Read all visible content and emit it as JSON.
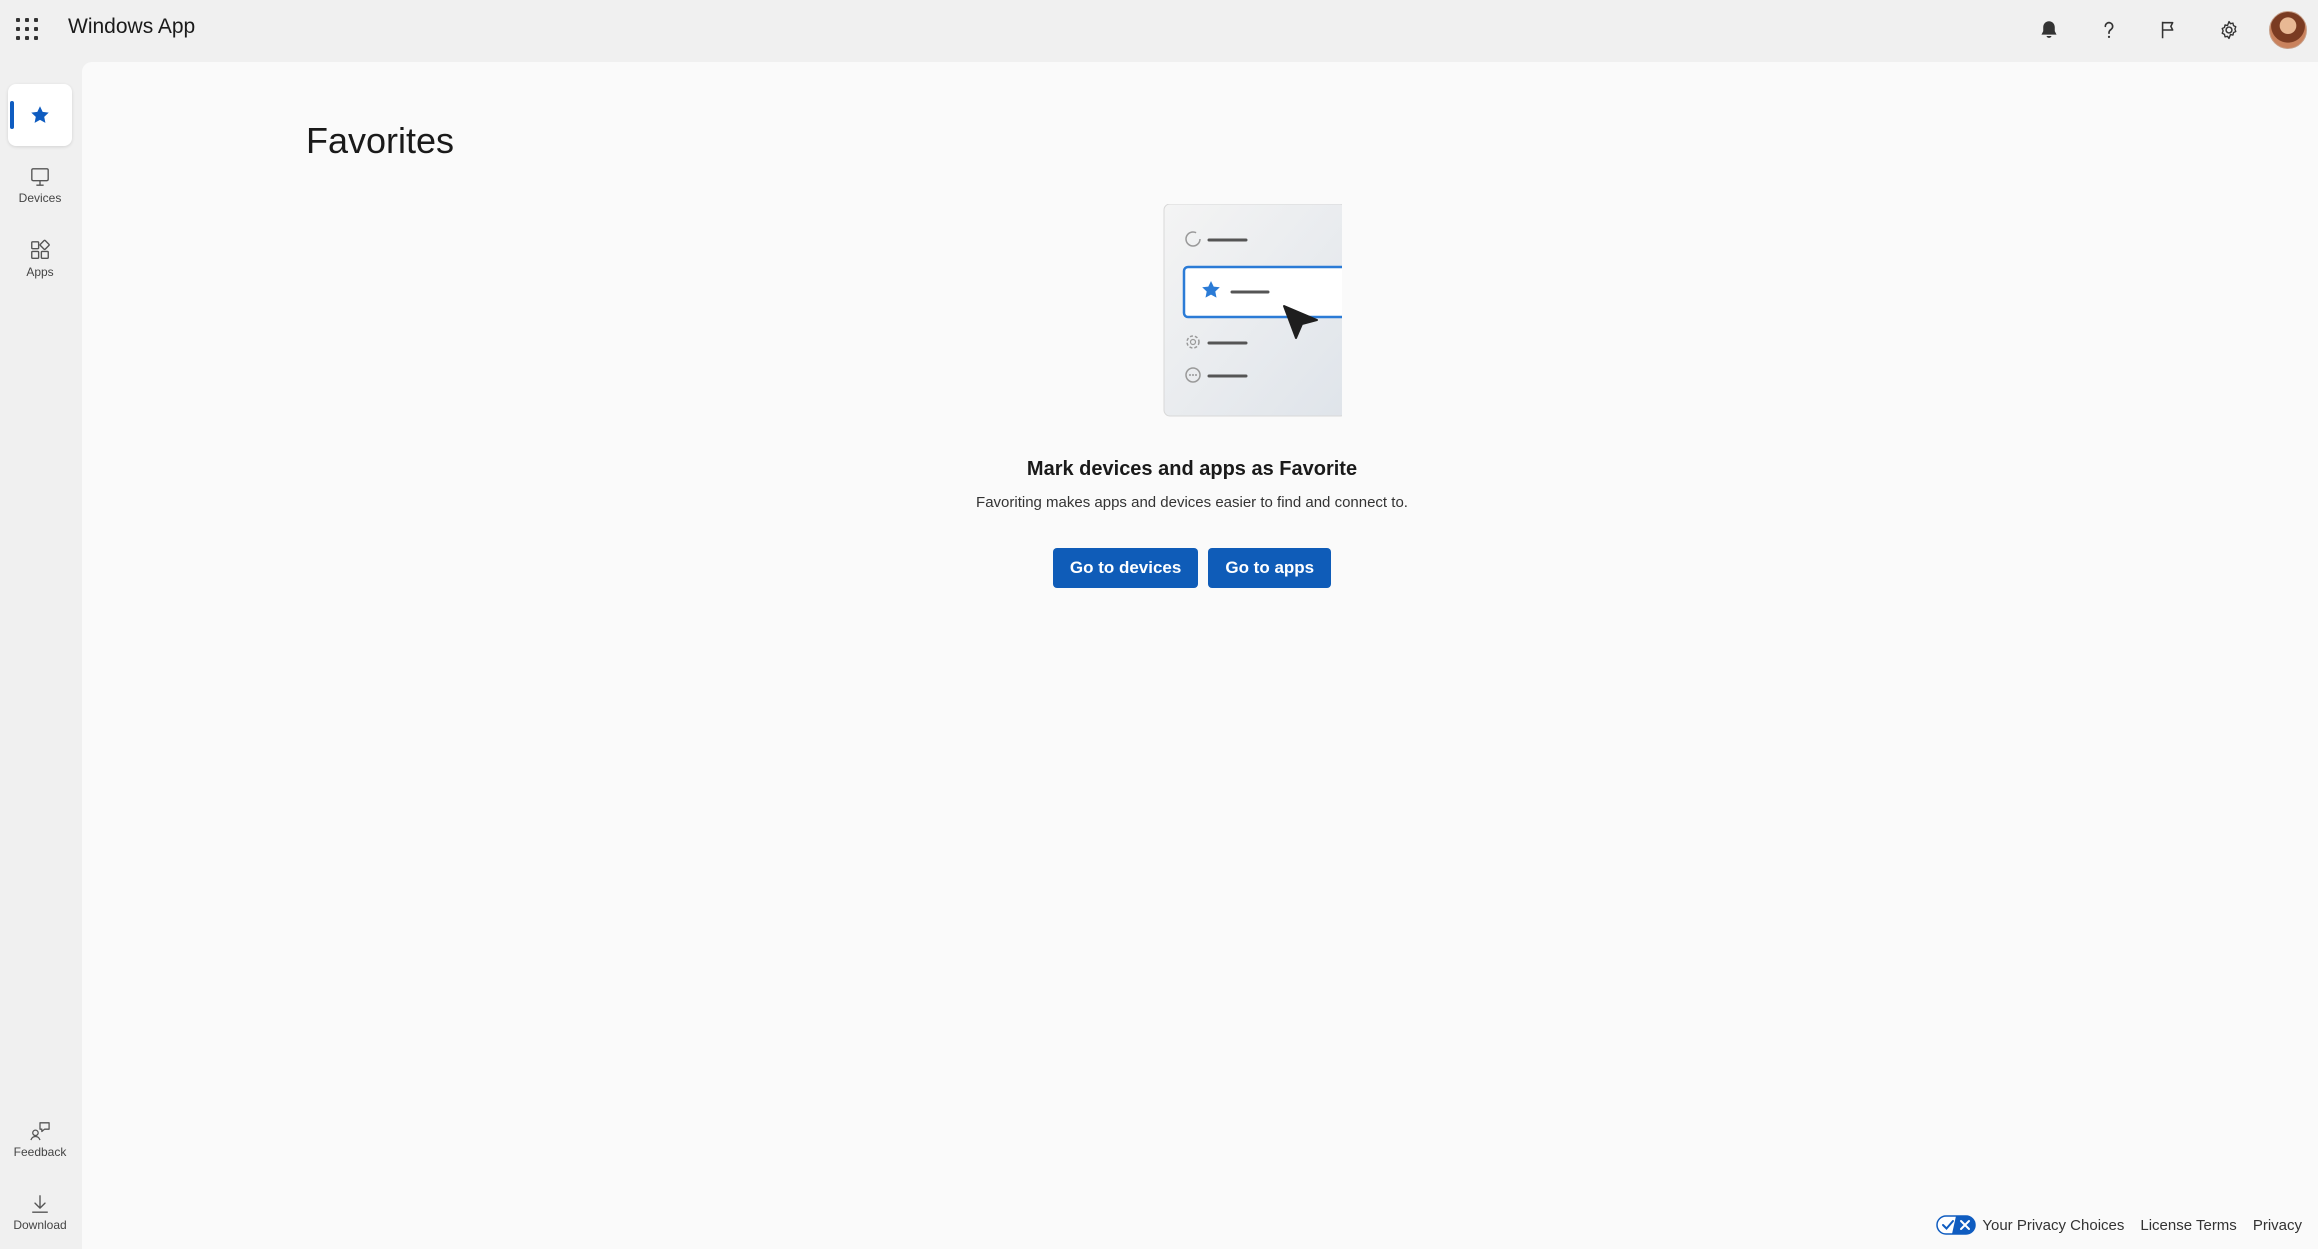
{
  "app": {
    "title": "Windows App"
  },
  "colors": {
    "accent": "#0f5cb8",
    "rail_indicator": "#0f5cc0",
    "star_blue": "#0f5cc0"
  },
  "header": {
    "icons": [
      "grid-icon",
      "bell-icon",
      "help-icon",
      "flag-icon",
      "gear-icon",
      "avatar"
    ]
  },
  "sidebar": {
    "items": [
      {
        "label": "",
        "icon": "star-icon",
        "active": true
      },
      {
        "label": "Devices",
        "icon": "monitor-icon"
      },
      {
        "label": "Apps",
        "icon": "apps-icon"
      }
    ],
    "bottom_items": [
      {
        "label": "Feedback",
        "icon": "feedback-icon"
      },
      {
        "label": "Download",
        "icon": "download-icon"
      }
    ]
  },
  "main": {
    "page_title": "Favorites",
    "empty_state": {
      "title": "Mark devices and apps as Favorite",
      "subtitle": "Favoriting makes apps and devices easier to find and connect to."
    },
    "buttons": {
      "go_to_devices": "Go to devices",
      "go_to_apps": "Go to apps"
    }
  },
  "footer": {
    "privacy_choices": "Your Privacy Choices",
    "license_terms": "License Terms",
    "privacy": "Privacy"
  }
}
